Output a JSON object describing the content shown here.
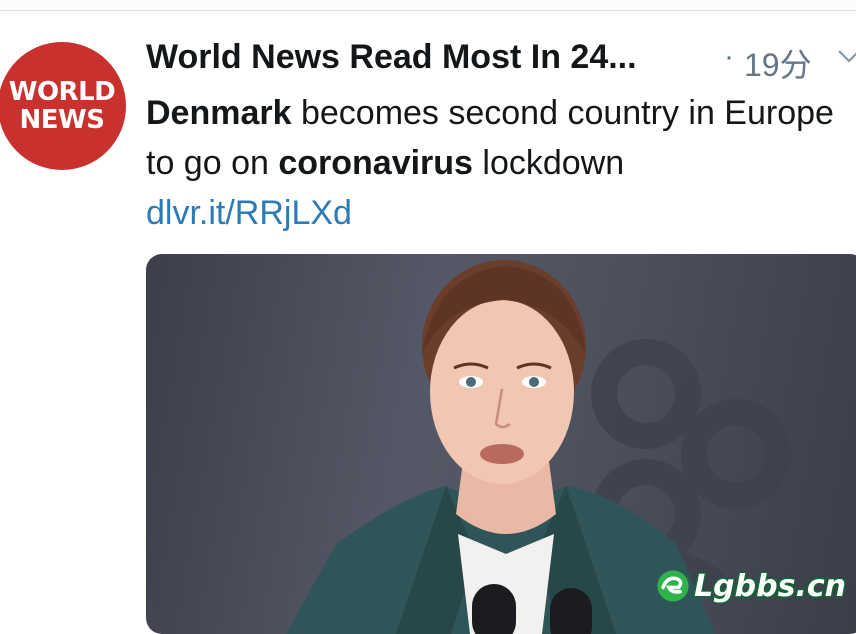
{
  "tweet": {
    "avatar": {
      "line1": "WORLD",
      "line2": "NEWS",
      "color": "#c8312e"
    },
    "author_name": "World News Read Most In 24...",
    "separator": "·",
    "timestamp": "19分",
    "text_parts": [
      {
        "text": "Denmark",
        "bold": true
      },
      {
        "text": " becomes second country in Europe to go on ",
        "bold": false
      },
      {
        "text": "coronavirus",
        "bold": true
      },
      {
        "text": " lockdown",
        "bold": false
      }
    ],
    "link": "dlvr.it/RRjLXd",
    "link_color": "#2b7bb9",
    "media": {
      "description_icon": "photo-of-speaker"
    }
  },
  "watermark": {
    "text": "Lgbbs.cn"
  }
}
